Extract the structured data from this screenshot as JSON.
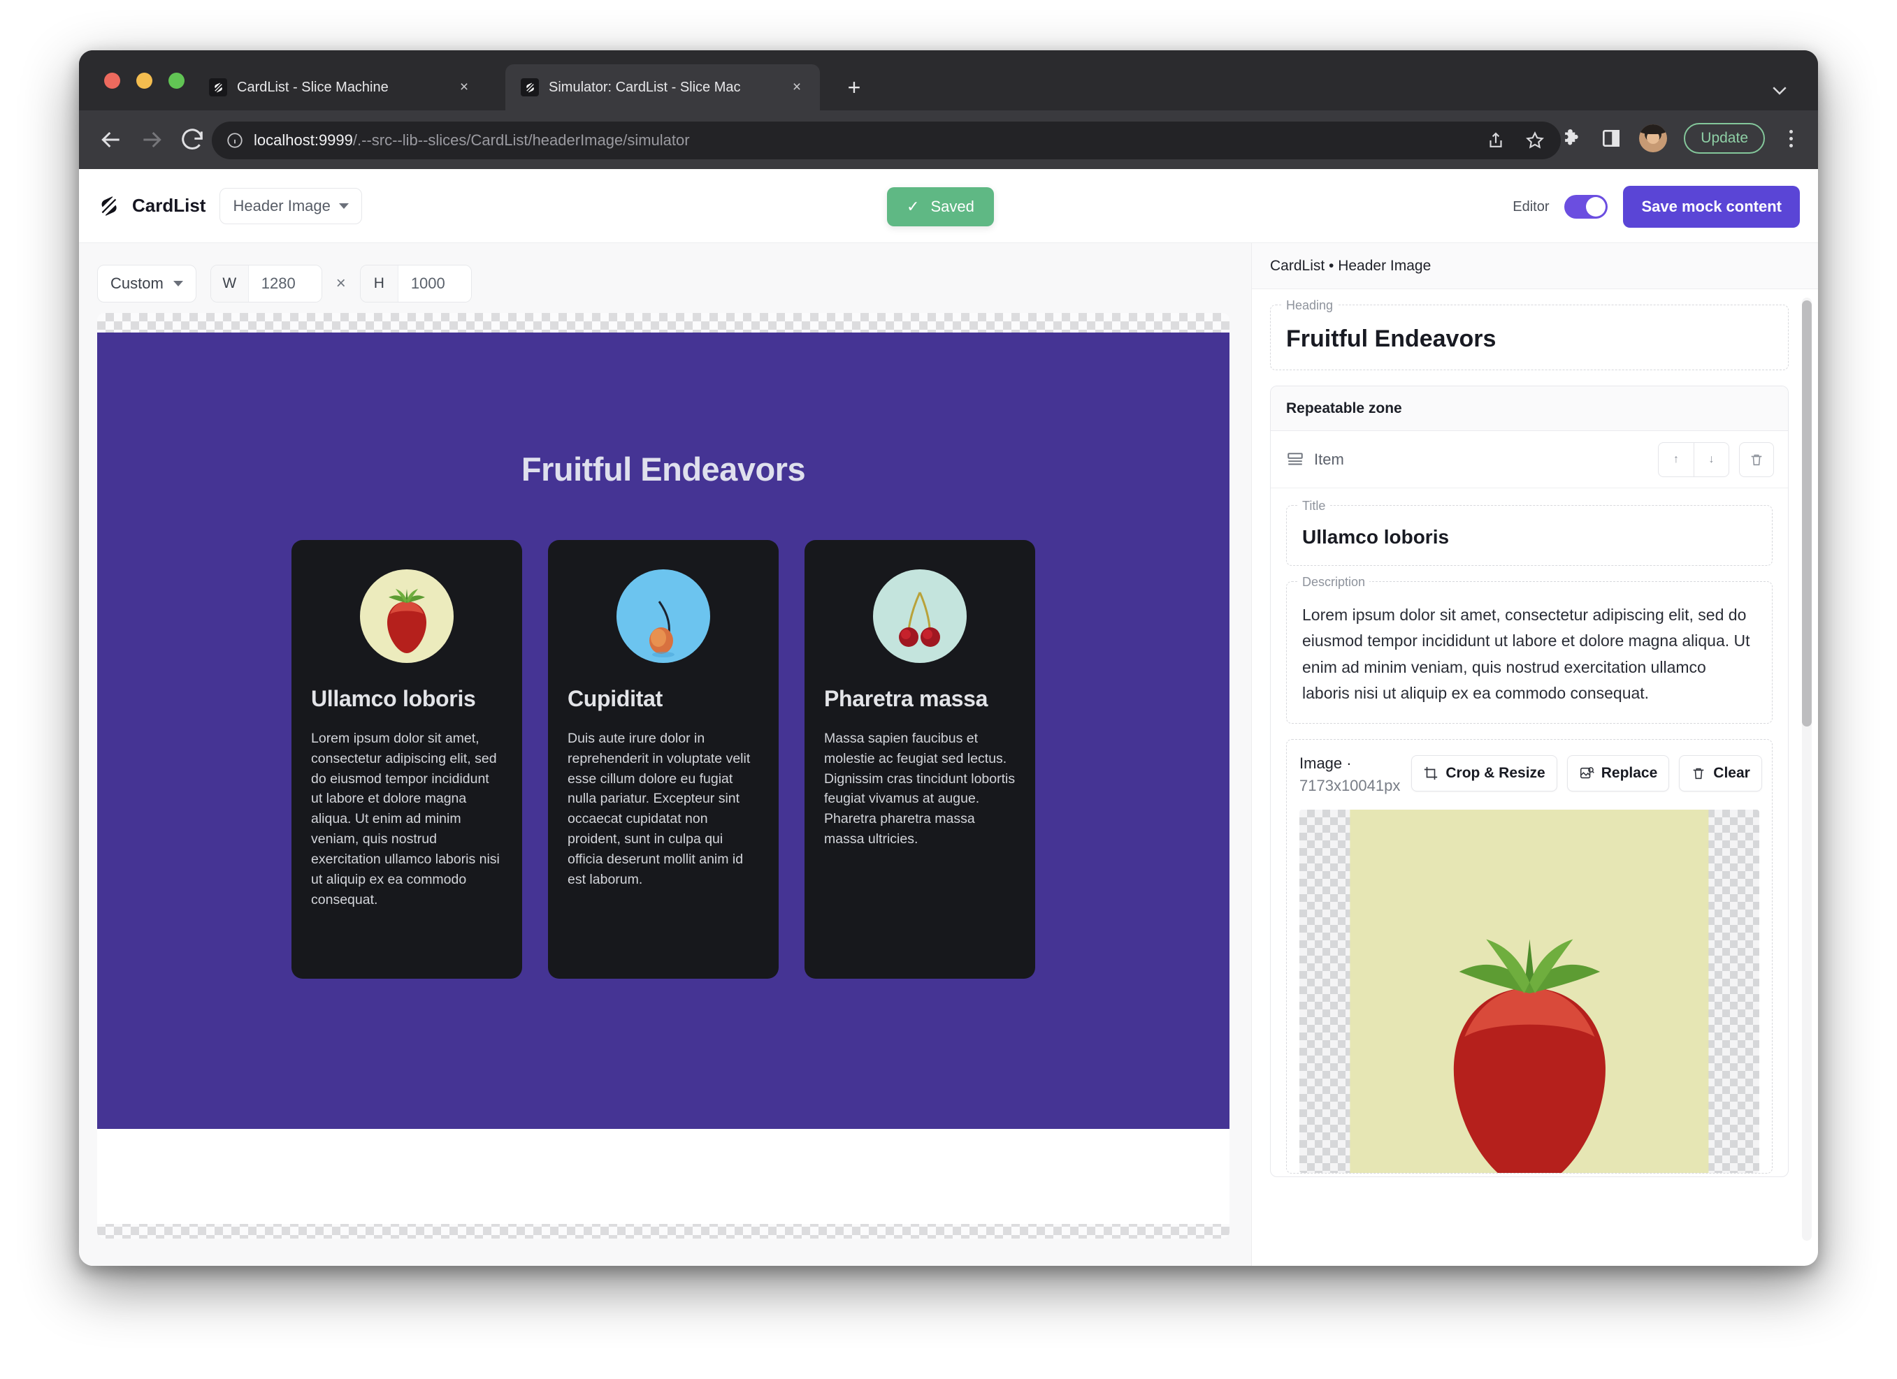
{
  "browser": {
    "tabs": [
      {
        "title": "CardList - Slice Machine",
        "active": false,
        "close_label": "×"
      },
      {
        "title": "Simulator: CardList - Slice Mac",
        "active": true,
        "close_label": "×"
      }
    ],
    "new_tab_label": "+",
    "url_host": "localhost:9999",
    "url_path": "/.--src--lib--slices/CardList/headerImage/simulator",
    "update_button": "Update",
    "icons": {
      "back": "back-arrow-icon",
      "forward": "forward-arrow-icon",
      "reload": "reload-icon",
      "info": "info-circle-icon",
      "share": "share-icon",
      "bookmark": "star-icon",
      "extensions": "puzzle-piece-icon",
      "sidepanel": "side-panel-icon",
      "profile": "avatar-icon",
      "menu": "kebab-menu-icon",
      "tab_list": "chevron-down-icon"
    }
  },
  "app_header": {
    "brand": "CardList",
    "slice_variation": "Header Image",
    "saved_label": "Saved",
    "saved_check": "✓",
    "saved_color": "#5fb884",
    "editor_label": "Editor",
    "editor_toggle_on": true,
    "toggle_color": "#6b4ee0",
    "save_mock_label": "Save mock content",
    "save_mock_color": "#5a45d6"
  },
  "simulator": {
    "preset": "Custom",
    "width_label": "W",
    "width_value": "1280",
    "times": "×",
    "height_label": "H",
    "height_value": "1000"
  },
  "preview": {
    "background_color": "#453494",
    "heading": "Fruitful Endeavors",
    "heading_color": "#dfe0ed",
    "cards": [
      {
        "title": "Ullamco loboris",
        "body": "Lorem ipsum dolor sit amet, consectetur adipiscing elit, sed do eiusmod tempor incididunt ut labore et dolore magna aliqua. Ut enim ad minim veniam, quis nostrud exercitation ullamco laboris nisi ut aliquip ex ea commodo consequat.",
        "thumb": "strawberry-image",
        "thumb_bg": "#ecebbd"
      },
      {
        "title": "Cupiditat",
        "body": "Duis aute irure dolor in reprehenderit in voluptate velit esse cillum dolore eu fugiat nulla pariatur. Excepteur sint occaecat cupidatat non proident, sunt in culpa qui officia deserunt mollit anim id est laborum.",
        "thumb": "apricot-image",
        "thumb_bg": "#6cc4ef"
      },
      {
        "title": "Pharetra massa",
        "body": "Massa sapien faucibus et molestie ac feugiat sed lectus. Dignissim cras tincidunt lobortis feugiat vivamus at augue. Pharetra pharetra massa massa ultricies.",
        "thumb": "cherries-image",
        "thumb_bg": "#c4e4dd"
      }
    ]
  },
  "editor_panel": {
    "breadcrumb": "CardList • Header Image",
    "heading_field": {
      "label": "Heading",
      "value": "Fruitful Endeavors"
    },
    "repeatable_zone": {
      "title": "Repeatable zone",
      "item_label": "Item",
      "actions": {
        "move_up": "↑",
        "move_down": "↓",
        "delete": "trash-icon"
      },
      "title_field": {
        "label": "Title",
        "value": "Ullamco loboris"
      },
      "description_field": {
        "label": "Description",
        "value": "Lorem ipsum dolor sit amet, consectetur adipiscing elit, sed do eiusmod tempor incididunt ut labore et dolore magna aliqua. Ut enim ad minim veniam, quis nostrud exercitation ullamco laboris nisi ut aliquip ex ea commodo consequat."
      },
      "image_field": {
        "label": "Image ·",
        "dimensions": "7173x10041px",
        "buttons": [
          {
            "label": "Crop & Resize",
            "icon": "crop-icon"
          },
          {
            "label": "Replace",
            "icon": "image-search-icon"
          },
          {
            "label": "Clear",
            "icon": "trash-icon"
          }
        ],
        "preview": "strawberry-image"
      }
    }
  }
}
